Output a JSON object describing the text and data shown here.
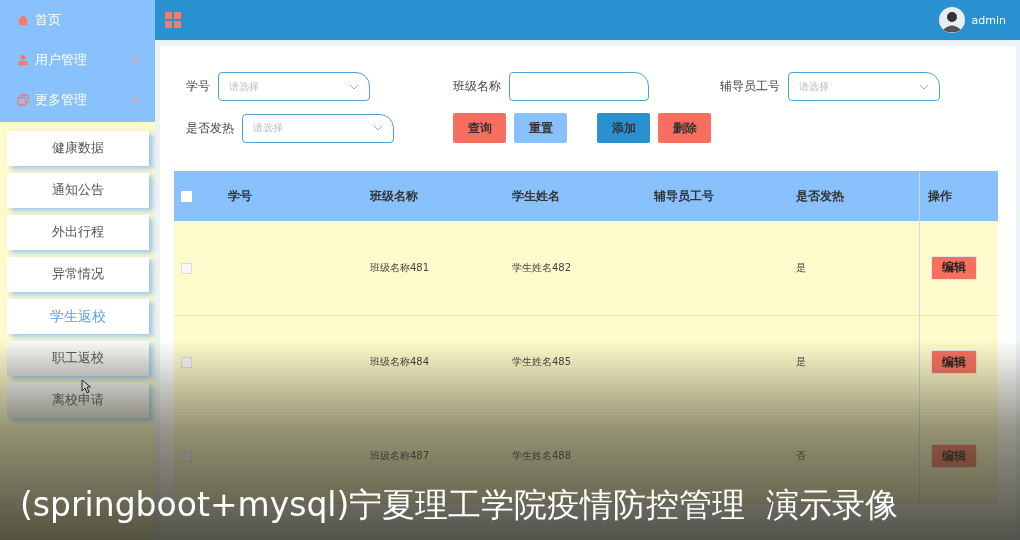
{
  "sidebar": {
    "menu": [
      {
        "label": "首页",
        "kind": "link"
      },
      {
        "label": "用户管理",
        "kind": "group",
        "expanded": false
      },
      {
        "label": "更多管理",
        "kind": "group",
        "expanded": true
      }
    ],
    "submenu": [
      {
        "label": "健康数据",
        "selected": false
      },
      {
        "label": "通知公告",
        "selected": false
      },
      {
        "label": "外出行程",
        "selected": false
      },
      {
        "label": "异常情况",
        "selected": false
      },
      {
        "label": "学生返校",
        "selected": true
      },
      {
        "label": "职工返校",
        "selected": false
      },
      {
        "label": "离校申请",
        "selected": false
      }
    ]
  },
  "header": {
    "user": "admin"
  },
  "filters": [
    {
      "label": "学号",
      "kind": "select",
      "placeholder": "请选择"
    },
    {
      "label": "班级名称",
      "kind": "input"
    },
    {
      "label": "辅导员工号",
      "kind": "select",
      "placeholder": "请选择"
    },
    {
      "label": "是否发热",
      "kind": "select",
      "placeholder": "请选择"
    }
  ],
  "buttons": [
    {
      "label": "查询",
      "kind": "search"
    },
    {
      "label": "重置",
      "kind": "reset"
    },
    {
      "label": "添加",
      "kind": "add"
    },
    {
      "label": "删除",
      "kind": "delete"
    }
  ],
  "table": {
    "header_checked": false,
    "columns": [
      "学号",
      "班级名称",
      "学生姓名",
      "辅导员工号",
      "是否发热",
      "操作"
    ],
    "rows": [
      {
        "checked": false,
        "cells": [
          "",
          "班级名称481",
          "学生姓名482",
          "",
          "是"
        ],
        "action": "编辑"
      },
      {
        "checked": false,
        "cells": [
          "",
          "班级名称484",
          "学生姓名485",
          "",
          "是"
        ],
        "action": "编辑"
      },
      {
        "checked": false,
        "cells": [
          "",
          "班级名称487",
          "学生姓名488",
          "",
          "否"
        ],
        "action": "编辑"
      }
    ]
  },
  "caption": "(springboot+mysql)宁夏理工学院疫情防控管理  演示录像"
}
